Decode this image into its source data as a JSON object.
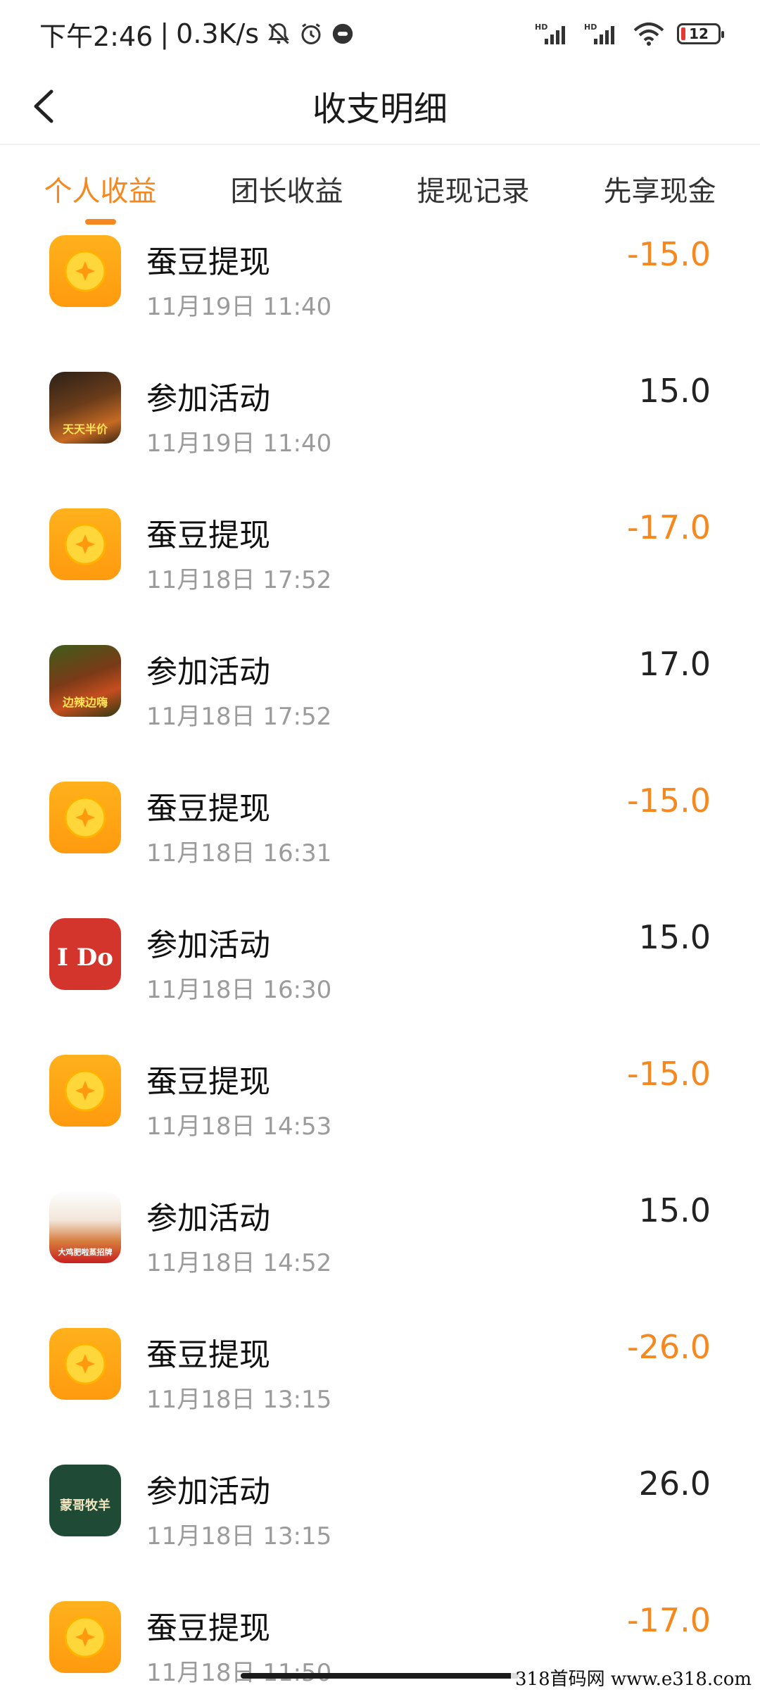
{
  "status_bar": {
    "time": "下午2:46",
    "separator": "|",
    "speed": "0.3K/s",
    "icons": [
      "bell-off-icon",
      "alarm-icon",
      "app-notification-icon",
      "hd-signal-icon",
      "hd-signal-icon",
      "wifi-icon"
    ],
    "network_labels": [
      "HD",
      "HD"
    ],
    "battery_level": "12",
    "battery_color": "#e53935"
  },
  "header": {
    "title": "收支明细",
    "back_icon": "chevron-left-icon"
  },
  "tabs": [
    {
      "label": "个人收益",
      "active": true
    },
    {
      "label": "团长收益",
      "active": false
    },
    {
      "label": "提现记录",
      "active": false
    },
    {
      "label": "先享现金",
      "active": false
    }
  ],
  "accent_color": "#f5881f",
  "transactions": [
    {
      "title": "蚕豆提现",
      "time": "11月19日 11:40",
      "amount": "-15.0",
      "icon": "coin-icon"
    },
    {
      "title": "参加活动",
      "time": "11月19日 11:40",
      "amount": "15.0",
      "icon": "burger-thumbnail",
      "thumb_text": "天天半价"
    },
    {
      "title": "蚕豆提现",
      "time": "11月18日 17:52",
      "amount": "-17.0",
      "icon": "coin-icon"
    },
    {
      "title": "参加活动",
      "time": "11月18日 17:52",
      "amount": "17.0",
      "icon": "hotpot-thumbnail",
      "thumb_text": "边辣边嗨"
    },
    {
      "title": "蚕豆提现",
      "time": "11月18日 16:31",
      "amount": "-15.0",
      "icon": "coin-icon"
    },
    {
      "title": "参加活动",
      "time": "11月18日 16:30",
      "amount": "15.0",
      "icon": "ido-thumbnail",
      "thumb_text": "I Do"
    },
    {
      "title": "蚕豆提现",
      "time": "11月18日 14:53",
      "amount": "-15.0",
      "icon": "coin-icon"
    },
    {
      "title": "参加活动",
      "time": "11月18日 14:52",
      "amount": "15.0",
      "icon": "dish-thumbnail",
      "thumb_text": "大鸡肥啦蒸招牌"
    },
    {
      "title": "蚕豆提现",
      "time": "11月18日 13:15",
      "amount": "-26.0",
      "icon": "coin-icon"
    },
    {
      "title": "参加活动",
      "time": "11月18日 13:15",
      "amount": "26.0",
      "icon": "lamb-thumbnail",
      "thumb_text": "蒙哥牧羊"
    },
    {
      "title": "蚕豆提现",
      "time": "11月18日 11:50",
      "amount": "-17.0",
      "icon": "coin-icon"
    }
  ],
  "watermark": "318首码网 www.e318.com"
}
